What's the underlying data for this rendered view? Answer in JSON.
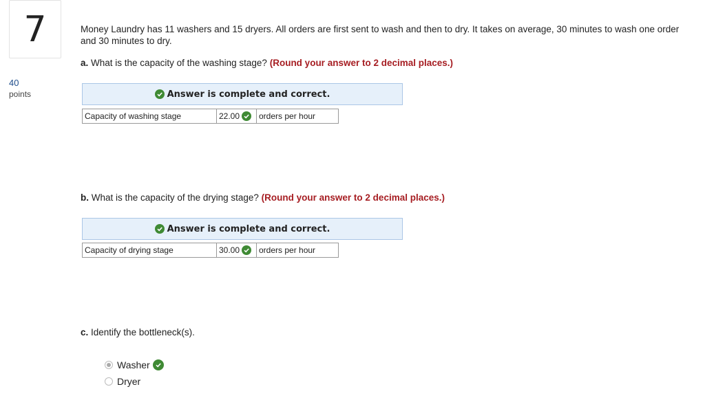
{
  "question": {
    "number": "7",
    "points_value": "40",
    "points_label": "points",
    "stem": "Money Laundry has 11 washers and 15 dryers. All orders are first sent to wash and then to dry. It takes on average, 30 minutes to wash one order and 30 minutes to dry."
  },
  "part_a": {
    "label": "a.",
    "prompt": "What is the capacity of the washing stage?",
    "round_note": "(Round your answer to 2 decimal places.)",
    "banner": "Answer is complete and correct.",
    "row_label": "Capacity of washing stage",
    "value": "22.00",
    "unit": "orders per hour"
  },
  "part_b": {
    "label": "b.",
    "prompt": "What is the capacity of the drying stage?",
    "round_note": "(Round your answer to 2 decimal places.)",
    "banner": "Answer is complete and correct.",
    "row_label": "Capacity of drying stage",
    "value": "30.00",
    "unit": "orders per hour"
  },
  "part_c": {
    "label": "c.",
    "prompt": "Identify the bottleneck(s).",
    "options": [
      {
        "label": "Washer",
        "selected": true,
        "correct": true
      },
      {
        "label": "Dryer",
        "selected": false,
        "correct": false
      }
    ]
  },
  "colors": {
    "accent_red": "#a61d22",
    "check_green": "#3f8a34",
    "banner_bg": "#e6f0fa"
  }
}
